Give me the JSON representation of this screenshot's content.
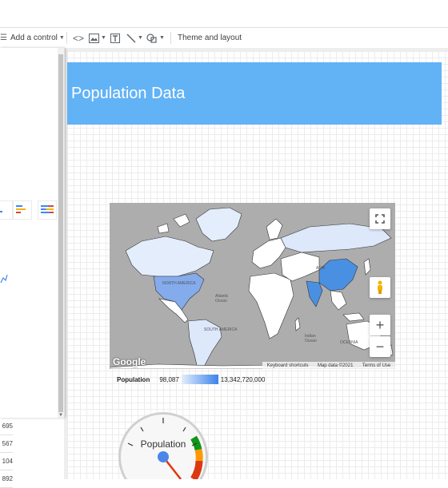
{
  "toolbar": {
    "add_control_label": "Add a control",
    "theme_layout_label": "Theme and layout"
  },
  "report": {
    "header_title": "Population Data"
  },
  "map": {
    "labels": {
      "north_america": "NORTH AMERICA",
      "south_america": "SOUTH AMERICA",
      "asia": "ASIA",
      "oceania": "OCEANIA",
      "atlantic": "Atlantic",
      "indian": "Indian",
      "ocean": "Ocean"
    },
    "google_logo": "Google",
    "attribution": {
      "keyboard_shortcuts": "Keyboard shortcuts",
      "map_data": "Map data ©2021",
      "terms": "Terms of Use"
    },
    "zoom_in": "+",
    "zoom_out": "−"
  },
  "legend": {
    "label": "Population",
    "min": "98,087",
    "max": "13,342,720,000"
  },
  "gauge": {
    "label": "Population"
  },
  "left_table": {
    "values": [
      "695",
      "567",
      "104",
      "892"
    ]
  },
  "colors": {
    "header": "#62b2f6",
    "china_fill": "#4a90e2",
    "land_light": "#e3edfb",
    "land_white": "#ffffff",
    "map_bg": "#adadad"
  }
}
